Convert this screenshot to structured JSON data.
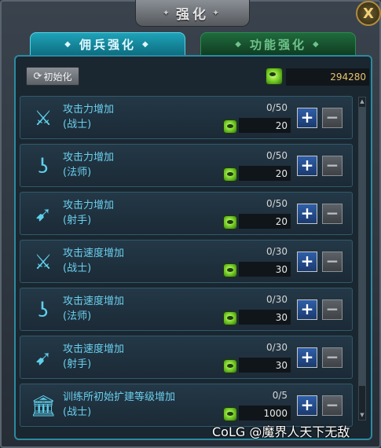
{
  "window": {
    "title": "强化",
    "close_label": "X"
  },
  "tabs": [
    {
      "label": "佣兵强化",
      "active": true
    },
    {
      "label": "功能强化",
      "active": false
    }
  ],
  "toolbar": {
    "reset_label": "初始化",
    "total_currency": "294280"
  },
  "items": [
    {
      "name": "攻击力增加\n(战士)",
      "icon": "sword-icon",
      "progress": "0/50",
      "cost": "20"
    },
    {
      "name": "攻击力增加\n(法师)",
      "icon": "staff-icon",
      "progress": "0/50",
      "cost": "20"
    },
    {
      "name": "攻击力增加\n(射手)",
      "icon": "bow-icon",
      "progress": "0/50",
      "cost": "20"
    },
    {
      "name": "攻击速度增加\n(战士)",
      "icon": "sword-icon",
      "progress": "0/30",
      "cost": "30"
    },
    {
      "name": "攻击速度增加\n(法师)",
      "icon": "staff-icon",
      "progress": "0/30",
      "cost": "30"
    },
    {
      "name": "攻击速度增加\n(射手)",
      "icon": "bow-icon",
      "progress": "0/30",
      "cost": "30"
    },
    {
      "name": "训练所初始扩建等级增加\n(战士)",
      "icon": "building-icon",
      "progress": "0/5",
      "cost": "1000"
    }
  ],
  "buttons": {
    "plus": "+",
    "minus": "−"
  },
  "watermark": "CoLG @魔界人天下无敌",
  "colors": {
    "accent": "#1ea3b8",
    "text_cyan": "#6ad0ee",
    "currency_gold": "#e8c36a",
    "coin_green": "#7bd22a"
  }
}
